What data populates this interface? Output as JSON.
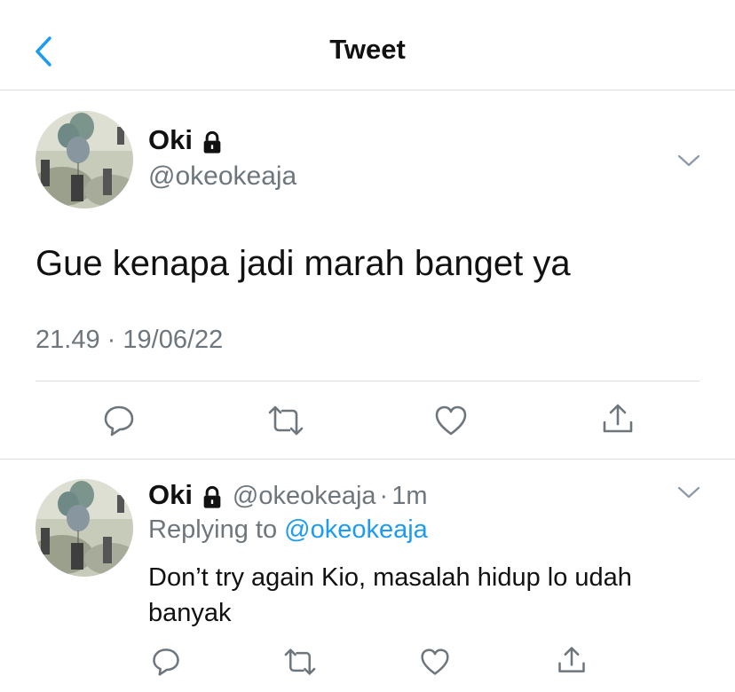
{
  "header": {
    "title": "Tweet",
    "back_icon": "chevron-left-icon"
  },
  "colors": {
    "accent": "#1d9bf0",
    "muted": "#6e767d",
    "divider": "#dcdde0"
  },
  "tweet": {
    "name": "Oki",
    "handle": "@okeokeaja",
    "text": "Gue kenapa jadi marah banget ya",
    "time": "21.49",
    "separator": "·",
    "date": "19/06/22",
    "actions": [
      "reply-icon",
      "retweet-icon",
      "like-icon",
      "share-icon"
    ]
  },
  "reply": {
    "name": "Oki",
    "handle": "@okeokeaja",
    "separator": "·",
    "age": "1m",
    "replying_prefix": "Replying to",
    "replying_to": "@okeokeaja",
    "text": "Don’t try again Kio, masalah hidup lo udah banyak"
  }
}
